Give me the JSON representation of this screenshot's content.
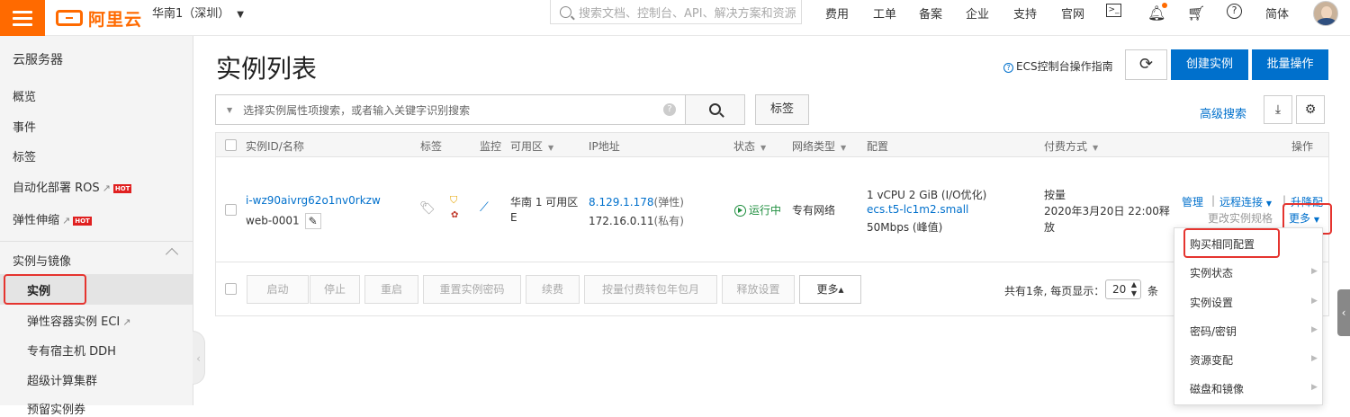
{
  "topbar": {
    "logo": "阿里云",
    "region": "华南1（深圳）",
    "search_placeholder": "搜索文档、控制台、API、解决方案和资源",
    "nav": [
      "费用",
      "工单",
      "备案",
      "企业",
      "支持",
      "官网"
    ],
    "lang": "简体"
  },
  "sidebar": {
    "title": "云服务器",
    "items": {
      "overview": "概览",
      "events": "事件",
      "tags": "标签",
      "ros": "自动化部署 ROS",
      "scaling": "弹性伸缩",
      "group": "实例与镜像",
      "instances": "实例",
      "eci": "弹性容器实例 ECI",
      "ddh": "专有宿主机 DDH",
      "super": "超级计算集群",
      "reserved": "预留实例券"
    },
    "hot": "HOT"
  },
  "main": {
    "title": "实例列表",
    "guide": "ECS控制台操作指南",
    "create_btn": "创建实例",
    "batch_btn": "批量操作",
    "filter_placeholder": "选择实例属性项搜索，或者输入关键字识别搜索",
    "tag_btn": "标签",
    "advanced_search": "高级搜索"
  },
  "table": {
    "headers": {
      "id": "实例ID/名称",
      "tags": "标签",
      "monitor": "监控",
      "zone": "可用区",
      "ip": "IP地址",
      "status": "状态",
      "network": "网络类型",
      "config": "配置",
      "billing": "付费方式",
      "actions": "操作"
    },
    "row": {
      "id": "i-wz90aivrg62o1nv0rkzw",
      "name": "web-0001",
      "zone_line1": "华南 1 可用区",
      "zone_line2": "E",
      "ip_public": "8.129.1.178",
      "ip_public_suffix": "(弹性)",
      "ip_private": "172.16.0.11",
      "ip_private_suffix": "(私有)",
      "status": "运行中",
      "network": "专有网络",
      "config_line1": "1 vCPU 2 GiB (I/O优化)",
      "config_type": "ecs.t5-lc1m2.small",
      "config_line3": "50Mbps (峰值)",
      "billing_line1": "按量",
      "billing_line2": "2020年3月20日 22:00释",
      "billing_line3": "放",
      "action_manage": "管理",
      "action_remote": "远程连接",
      "action_upgrade": "升降配",
      "action_change": "更改实例规格",
      "action_more": "更多"
    },
    "bottom_buttons": [
      "启动",
      "停止",
      "重启",
      "重置实例密码",
      "续费",
      "按量付费转包年包月",
      "释放设置"
    ],
    "bottom_more": "更多▴",
    "pager_total": "共有1条, 每页显示：",
    "page_size": "20",
    "pager_unit": "条"
  },
  "dropdown": [
    "购买相同配置",
    "实例状态",
    "实例设置",
    "密码/密钥",
    "资源变配",
    "磁盘和镜像"
  ],
  "colors": {
    "brand": "#ff6a00",
    "primary": "#0070cc",
    "highlight": "#e5342f",
    "running": "#1e8e3e"
  }
}
